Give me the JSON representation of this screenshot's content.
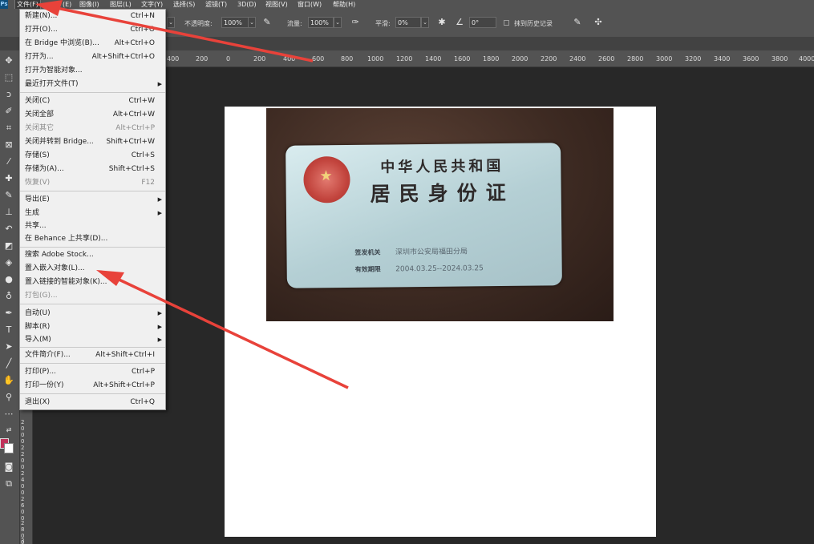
{
  "menubar": {
    "app_icon": "Ps",
    "items": [
      "文件(F)",
      "编辑(E)",
      "图像(I)",
      "图层(L)",
      "文字(Y)",
      "选择(S)",
      "滤镜(T)",
      "3D(D)",
      "视图(V)",
      "窗口(W)",
      "帮助(H)"
    ],
    "visible_items": [
      "文件(F)",
      "(E)",
      "图像(I)",
      "图层(L)",
      "文字(Y)",
      "选择(S)",
      "滤镜(T)",
      "3D(D)",
      "视图(V)",
      "窗口(W)",
      "帮助(H)"
    ]
  },
  "options_bar": {
    "opacity_label": "不透明度:",
    "opacity_value": "100%",
    "flow_label": "流量:",
    "flow_value": "100%",
    "smoothing_label": "平滑:",
    "smoothing_value": "0%",
    "angle_value": "0°",
    "erase_history_label": "抹到历史记录"
  },
  "ruler": {
    "h_ticks": [
      "400",
      "200",
      "0",
      "200",
      "400",
      "600",
      "800",
      "1000",
      "1200",
      "1400",
      "1600",
      "1800",
      "2000",
      "2200",
      "2400",
      "2600",
      "2800",
      "3000",
      "3200",
      "3400",
      "3600",
      "3800",
      "4000"
    ],
    "v_ticks": [
      "2000",
      "2200",
      "2400",
      "2600",
      "2800",
      "3"
    ]
  },
  "file_menu": {
    "items": [
      {
        "label": "新建(N)...",
        "shortcut": "Ctrl+N",
        "disabled": false
      },
      {
        "label": "打开(O)...",
        "shortcut": "Ctrl+O",
        "disabled": false
      },
      {
        "label": "在 Bridge 中浏览(B)...",
        "shortcut": "Alt+Ctrl+O",
        "disabled": false
      },
      {
        "label": "打开为...",
        "shortcut": "Alt+Shift+Ctrl+O",
        "disabled": false
      },
      {
        "label": "打开为智能对象...",
        "shortcut": "",
        "disabled": false
      },
      {
        "label": "最近打开文件(T)",
        "shortcut": "",
        "disabled": false,
        "submenu": true
      },
      {
        "label": "关闭(C)",
        "shortcut": "Ctrl+W",
        "disabled": false
      },
      {
        "label": "关闭全部",
        "shortcut": "Alt+Ctrl+W",
        "disabled": false
      },
      {
        "label": "关闭其它",
        "shortcut": "Alt+Ctrl+P",
        "disabled": true
      },
      {
        "label": "关闭并转到 Bridge...",
        "shortcut": "Shift+Ctrl+W",
        "disabled": false
      },
      {
        "label": "存储(S)",
        "shortcut": "Ctrl+S",
        "disabled": false
      },
      {
        "label": "存储为(A)...",
        "shortcut": "Shift+Ctrl+S",
        "disabled": false
      },
      {
        "label": "恢复(V)",
        "shortcut": "F12",
        "disabled": true
      },
      {
        "label": "导出(E)",
        "shortcut": "",
        "disabled": false,
        "submenu": true
      },
      {
        "label": "生成",
        "shortcut": "",
        "disabled": false,
        "submenu": true
      },
      {
        "label": "共享...",
        "shortcut": "",
        "disabled": false
      },
      {
        "label": "在 Behance 上共享(D)...",
        "shortcut": "",
        "disabled": false
      },
      {
        "label": "搜索 Adobe Stock...",
        "shortcut": "",
        "disabled": false
      },
      {
        "label": "置入嵌入对象(L)...",
        "shortcut": "",
        "disabled": false
      },
      {
        "label": "置入链接的智能对象(K)...",
        "shortcut": "",
        "disabled": false
      },
      {
        "label": "打包(G)...",
        "shortcut": "",
        "disabled": true
      },
      {
        "label": "自动(U)",
        "shortcut": "",
        "disabled": false,
        "submenu": true
      },
      {
        "label": "脚本(R)",
        "shortcut": "",
        "disabled": false,
        "submenu": true
      },
      {
        "label": "导入(M)",
        "shortcut": "",
        "disabled": false,
        "submenu": true
      },
      {
        "label": "文件简介(F)...",
        "shortcut": "Alt+Shift+Ctrl+I",
        "disabled": false
      },
      {
        "label": "打印(P)...",
        "shortcut": "Ctrl+P",
        "disabled": false
      },
      {
        "label": "打印一份(Y)",
        "shortcut": "Alt+Shift+Ctrl+P",
        "disabled": false
      },
      {
        "label": "退出(X)",
        "shortcut": "Ctrl+Q",
        "disabled": false
      }
    ]
  },
  "id_card": {
    "title": "中华人民共和国",
    "subtitle": "居民身份证",
    "issuer_key": "签发机关",
    "issuer_value": "深圳市公安局福田分局",
    "valid_key": "有效期限",
    "valid_value": "2004.03.25--2024.03.25"
  },
  "colors": {
    "foreground": "#c0325a",
    "background": "#ffffff",
    "annotation_arrow": "#e8423a"
  }
}
